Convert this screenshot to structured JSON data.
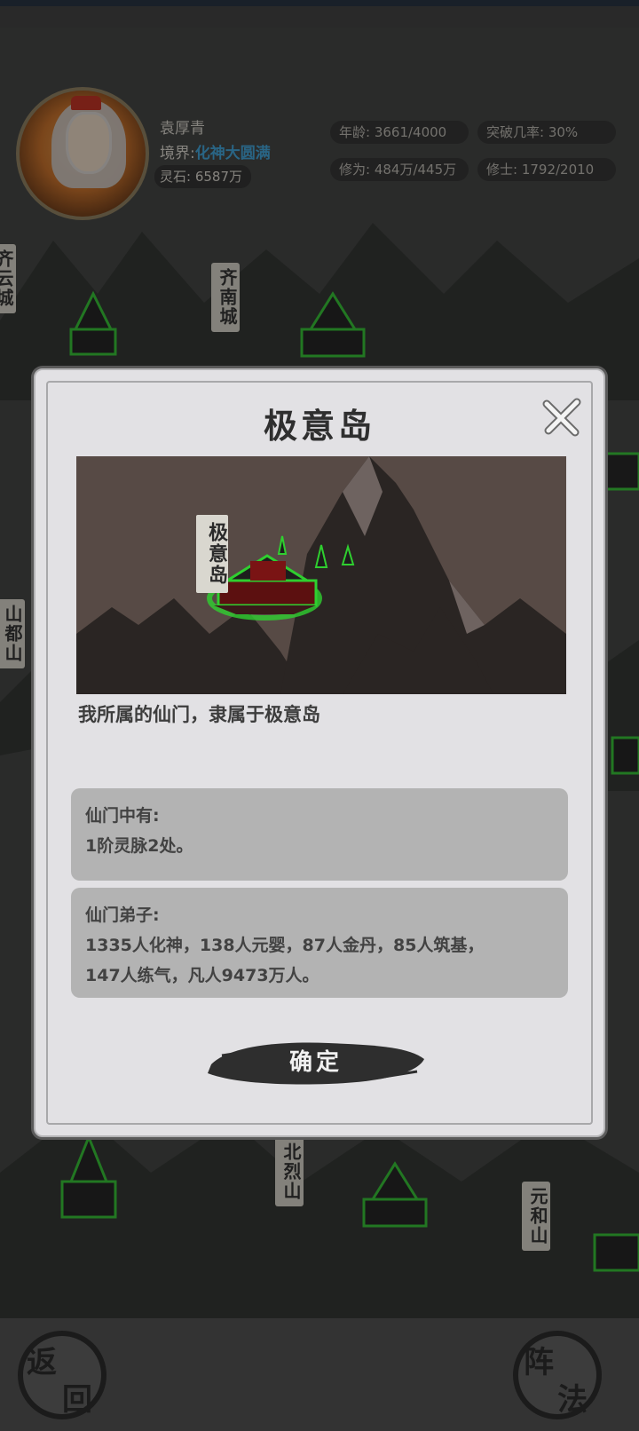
{
  "player": {
    "name": "袁厚青",
    "realm_label": "境界:",
    "realm_value": "化神大圆满",
    "spirit_stone": "灵石: 6587万"
  },
  "stats": {
    "age": "年龄: 3661/4000",
    "breakthrough": "突破几率: 30%",
    "cultivation": "修为: 484万/445万",
    "cultivators": "修士: 1792/2010"
  },
  "map_labels": {
    "qinan": "齐南城",
    "qiyun": "齐云城",
    "shandu": "山都山",
    "beilie": "北烈山",
    "yuanhe": "元和山"
  },
  "bottom": {
    "back": [
      "返",
      "回"
    ],
    "formation": [
      "阵",
      "法"
    ]
  },
  "dialog": {
    "title": "极意岛",
    "scene_label": "极意岛",
    "description": "我所属的仙门，隶属于极意岛",
    "resources_title": "仙门中有:",
    "resources_text": "1阶灵脉2处。",
    "disciples_title": "仙门弟子:",
    "disciples_line1": "1335人化神，138人元婴，87人金丹，85人筑基，",
    "disciples_line2": "147人练气，凡人9473万人。",
    "confirm": "确定"
  },
  "colors": {
    "realm": "#3aa0d8",
    "dialog_bg": "#e2e1e4",
    "info_bg": "#b3b3b3",
    "scene_bg": "#574a45",
    "glow": "#2fcf2f"
  }
}
